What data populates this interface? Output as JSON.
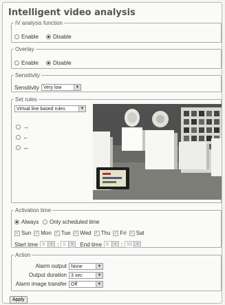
{
  "title": "Intelligent video analysis",
  "iv_analysis": {
    "legend": "IV analysis function",
    "options": [
      "Enable",
      "Disable"
    ],
    "selected": "Disable"
  },
  "overlay": {
    "legend": "Overlay",
    "options": [
      "Enable",
      "Disable"
    ],
    "selected": "Disable"
  },
  "sensitivity": {
    "legend": "Sensitivity",
    "label": "Sensitivity",
    "value": "Very low"
  },
  "set_rules": {
    "legend": "Set rules",
    "rule_type": "Virtual line based rules",
    "directions": [
      "→",
      "←",
      "↔"
    ]
  },
  "activation_time": {
    "legend": "Activation time",
    "modes": [
      "Always",
      "Only scheduled time"
    ],
    "selected": "Always",
    "days": [
      "Sun",
      "Mon",
      "Tue",
      "Wed",
      "Thu",
      "Fri",
      "Sat"
    ],
    "start_label": "Start time",
    "start_hour": "9",
    "start_min": "0",
    "end_label": "End time",
    "end_hour": "8",
    "end_min": "59",
    "colon": ":"
  },
  "action": {
    "legend": "Action",
    "alarm_output_label": "Alarm output",
    "alarm_output_value": "None",
    "output_duration_label": "Output duration",
    "output_duration_value": "3 sec",
    "alarm_image_label": "Alarm image transfer",
    "alarm_image_value": "Off"
  },
  "apply_label": "Apply",
  "colors": {
    "background": "#f4f4f1",
    "panel_border": "#b9b9b2",
    "title": "#555555"
  },
  "icons": {
    "select_arrow": "chevron-down-icon",
    "checkbox": "check-icon"
  }
}
